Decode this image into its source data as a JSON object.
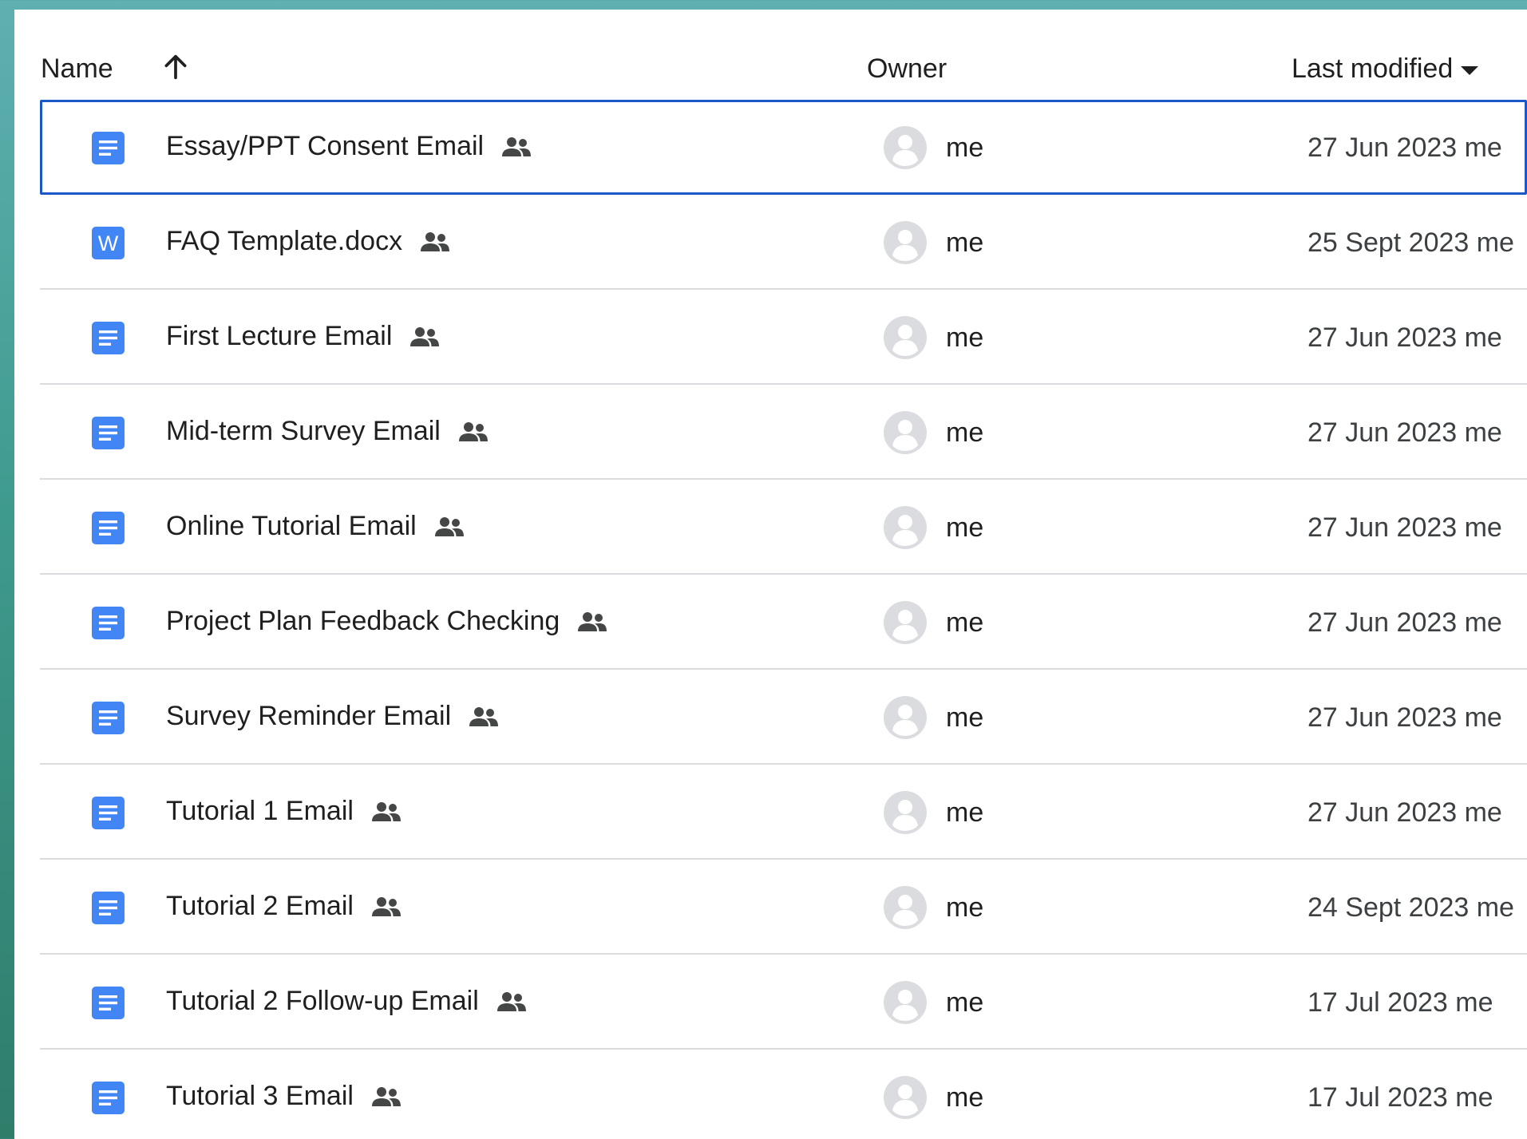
{
  "columns": {
    "name": "Name",
    "owner": "Owner",
    "last_modified": "Last modified"
  },
  "sort": {
    "column": "name",
    "direction": "ascending",
    "modified_menu_icon": "caret-down-icon"
  },
  "colors": {
    "selection": "#1a57c7",
    "docs_blue": "#4285f4",
    "divider": "#dadce0"
  },
  "files": [
    {
      "name": "Essay/PPT Consent Email",
      "type": "google-docs",
      "shared": true,
      "owner": "me",
      "modified": "27 Jun 2023 me",
      "selected": true
    },
    {
      "name": "FAQ Template.docx",
      "type": "word-docx",
      "icon_letter": "W",
      "shared": true,
      "owner": "me",
      "modified": "25 Sept 2023 me",
      "selected": false
    },
    {
      "name": "First Lecture Email",
      "type": "google-docs",
      "shared": true,
      "owner": "me",
      "modified": "27 Jun 2023 me",
      "selected": false
    },
    {
      "name": "Mid-term Survey Email",
      "type": "google-docs",
      "shared": true,
      "owner": "me",
      "modified": "27 Jun 2023 me",
      "selected": false
    },
    {
      "name": "Online Tutorial Email",
      "type": "google-docs",
      "shared": true,
      "owner": "me",
      "modified": "27 Jun 2023 me",
      "selected": false
    },
    {
      "name": "Project Plan Feedback Checking",
      "type": "google-docs",
      "shared": true,
      "owner": "me",
      "modified": "27 Jun 2023 me",
      "selected": false
    },
    {
      "name": "Survey Reminder Email",
      "type": "google-docs",
      "shared": true,
      "owner": "me",
      "modified": "27 Jun 2023 me",
      "selected": false
    },
    {
      "name": "Tutorial 1 Email",
      "type": "google-docs",
      "shared": true,
      "owner": "me",
      "modified": "27 Jun 2023 me",
      "selected": false
    },
    {
      "name": "Tutorial 2 Email",
      "type": "google-docs",
      "shared": true,
      "owner": "me",
      "modified": "24 Sept 2023 me",
      "selected": false
    },
    {
      "name": "Tutorial 2 Follow-up Email",
      "type": "google-docs",
      "shared": true,
      "owner": "me",
      "modified": "17 Jul 2023 me",
      "selected": false
    },
    {
      "name": "Tutorial 3 Email",
      "type": "google-docs",
      "shared": true,
      "owner": "me",
      "modified": "17 Jul 2023 me",
      "selected": false
    }
  ]
}
